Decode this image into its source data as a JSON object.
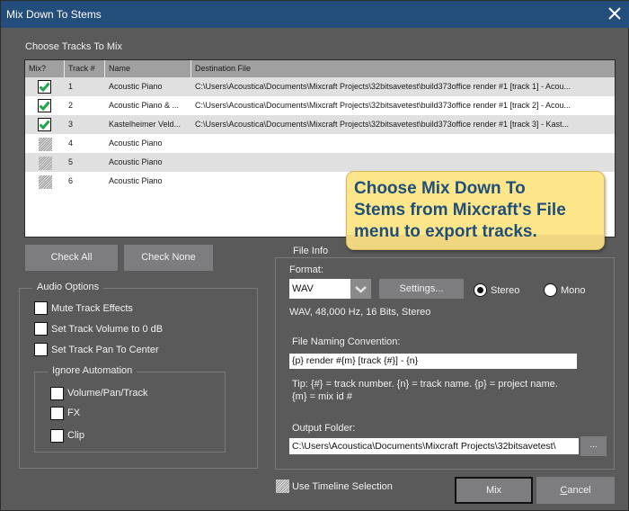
{
  "window": {
    "title": "Mix Down To Stems",
    "close_icon": "close-icon"
  },
  "tracks_section": {
    "label": "Choose Tracks To Mix",
    "columns": [
      "Mix?",
      "Track #",
      "Name",
      "Destination File"
    ],
    "rows": [
      {
        "mix": "checked",
        "track": "1",
        "name": "Acoustic Piano",
        "destination": "C:\\Users\\Acoustica\\Documents\\Mixcraft Projects\\32bitsavetest\\build373office render #1 [track 1] - Acou..."
      },
      {
        "mix": "checked",
        "track": "2",
        "name": "Acoustic Piano & ...",
        "destination": "C:\\Users\\Acoustica\\Documents\\Mixcraft Projects\\32bitsavetest\\build373office render #1 [track 2] - Acou..."
      },
      {
        "mix": "checked",
        "track": "3",
        "name": "Kastelheimer Veld...",
        "destination": "C:\\Users\\Acoustica\\Documents\\Mixcraft Projects\\32bitsavetest\\build373office render #1 [track 3] - Kast..."
      },
      {
        "mix": "indeterminate",
        "track": "4",
        "name": "Acoustic Piano",
        "destination": ""
      },
      {
        "mix": "indeterminate",
        "track": "5",
        "name": "Acoustic Piano",
        "destination": ""
      },
      {
        "mix": "indeterminate",
        "track": "6",
        "name": "Acoustic Piano",
        "destination": ""
      }
    ],
    "check_all_label": "Check All",
    "check_none_label": "Check None"
  },
  "tooltip": {
    "lines": [
      "Choose Mix Down To",
      "Stems from Mixcraft's File",
      "menu to export tracks."
    ]
  },
  "audio_options": {
    "legend": "Audio Options",
    "options": [
      {
        "label": "Mute Track Effects",
        "checked": false
      },
      {
        "label": "Set Track Volume to 0 dB",
        "checked": false
      },
      {
        "label": "Set Track Pan To Center",
        "checked": false
      }
    ],
    "ignore_automation": {
      "legend": "Ignore Automation",
      "options": [
        {
          "label": "Volume/Pan/Track",
          "checked": false
        },
        {
          "label": "FX",
          "checked": false
        },
        {
          "label": "Clip",
          "checked": false
        }
      ]
    }
  },
  "file_info": {
    "legend": "File Info",
    "format_label": "Format:",
    "format_value": "WAV",
    "settings_label": "Settings...",
    "channel_options": [
      {
        "label": "Stereo",
        "selected": true
      },
      {
        "label": "Mono",
        "selected": false
      }
    ],
    "format_summary": "WAV, 48,000 Hz, 16 Bits, Stereo",
    "naming_label": "File Naming Convention:",
    "naming_value": "{p} render #{m} [track {#}] - {n}",
    "tip_line1": "Tip: {#} = track number. {n} = track name. {p} = project name.",
    "tip_line2": "{m} = mix id #",
    "output_label": "Output Folder:",
    "output_value": "C:\\Users\\Acoustica\\Documents\\Mixcraft Projects\\32bitsavetest\\",
    "browse_label": "..."
  },
  "footer": {
    "use_timeline_label": "Use Timeline Selection",
    "use_timeline_state": "indeterminate",
    "mix_label": "Mix",
    "cancel_label": "Cancel"
  },
  "colors": {
    "titlebar": "#234e7c",
    "background": "#5a5a5a",
    "button": "#7d7d80",
    "check_green": "#1fa54a",
    "tooltip_bg": "#fde68a",
    "tooltip_text": "#1f4e79"
  }
}
